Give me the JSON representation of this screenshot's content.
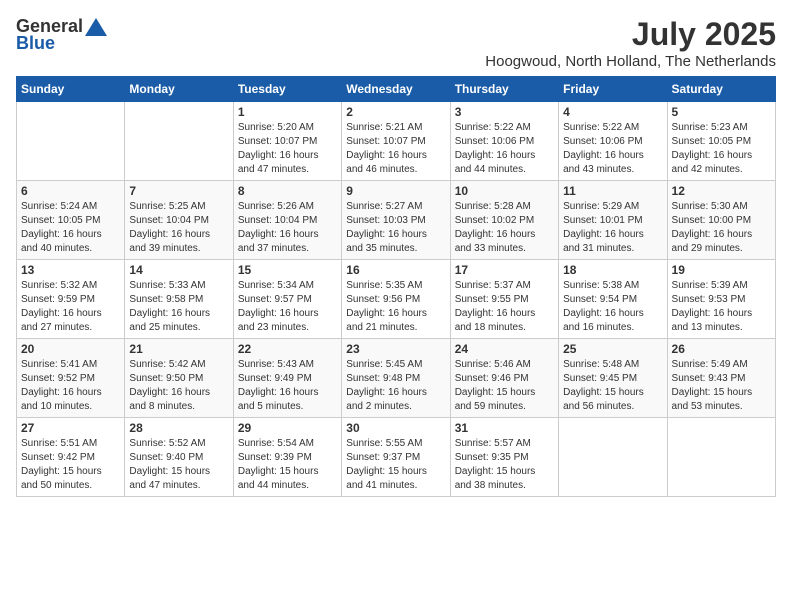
{
  "header": {
    "logo_general": "General",
    "logo_blue": "Blue",
    "month_year": "July 2025",
    "location": "Hoogwoud, North Holland, The Netherlands"
  },
  "days_of_week": [
    "Sunday",
    "Monday",
    "Tuesday",
    "Wednesday",
    "Thursday",
    "Friday",
    "Saturday"
  ],
  "weeks": [
    [
      {
        "day": "",
        "info": ""
      },
      {
        "day": "",
        "info": ""
      },
      {
        "day": "1",
        "info": "Sunrise: 5:20 AM\nSunset: 10:07 PM\nDaylight: 16 hours\nand 47 minutes."
      },
      {
        "day": "2",
        "info": "Sunrise: 5:21 AM\nSunset: 10:07 PM\nDaylight: 16 hours\nand 46 minutes."
      },
      {
        "day": "3",
        "info": "Sunrise: 5:22 AM\nSunset: 10:06 PM\nDaylight: 16 hours\nand 44 minutes."
      },
      {
        "day": "4",
        "info": "Sunrise: 5:22 AM\nSunset: 10:06 PM\nDaylight: 16 hours\nand 43 minutes."
      },
      {
        "day": "5",
        "info": "Sunrise: 5:23 AM\nSunset: 10:05 PM\nDaylight: 16 hours\nand 42 minutes."
      }
    ],
    [
      {
        "day": "6",
        "info": "Sunrise: 5:24 AM\nSunset: 10:05 PM\nDaylight: 16 hours\nand 40 minutes."
      },
      {
        "day": "7",
        "info": "Sunrise: 5:25 AM\nSunset: 10:04 PM\nDaylight: 16 hours\nand 39 minutes."
      },
      {
        "day": "8",
        "info": "Sunrise: 5:26 AM\nSunset: 10:04 PM\nDaylight: 16 hours\nand 37 minutes."
      },
      {
        "day": "9",
        "info": "Sunrise: 5:27 AM\nSunset: 10:03 PM\nDaylight: 16 hours\nand 35 minutes."
      },
      {
        "day": "10",
        "info": "Sunrise: 5:28 AM\nSunset: 10:02 PM\nDaylight: 16 hours\nand 33 minutes."
      },
      {
        "day": "11",
        "info": "Sunrise: 5:29 AM\nSunset: 10:01 PM\nDaylight: 16 hours\nand 31 minutes."
      },
      {
        "day": "12",
        "info": "Sunrise: 5:30 AM\nSunset: 10:00 PM\nDaylight: 16 hours\nand 29 minutes."
      }
    ],
    [
      {
        "day": "13",
        "info": "Sunrise: 5:32 AM\nSunset: 9:59 PM\nDaylight: 16 hours\nand 27 minutes."
      },
      {
        "day": "14",
        "info": "Sunrise: 5:33 AM\nSunset: 9:58 PM\nDaylight: 16 hours\nand 25 minutes."
      },
      {
        "day": "15",
        "info": "Sunrise: 5:34 AM\nSunset: 9:57 PM\nDaylight: 16 hours\nand 23 minutes."
      },
      {
        "day": "16",
        "info": "Sunrise: 5:35 AM\nSunset: 9:56 PM\nDaylight: 16 hours\nand 21 minutes."
      },
      {
        "day": "17",
        "info": "Sunrise: 5:37 AM\nSunset: 9:55 PM\nDaylight: 16 hours\nand 18 minutes."
      },
      {
        "day": "18",
        "info": "Sunrise: 5:38 AM\nSunset: 9:54 PM\nDaylight: 16 hours\nand 16 minutes."
      },
      {
        "day": "19",
        "info": "Sunrise: 5:39 AM\nSunset: 9:53 PM\nDaylight: 16 hours\nand 13 minutes."
      }
    ],
    [
      {
        "day": "20",
        "info": "Sunrise: 5:41 AM\nSunset: 9:52 PM\nDaylight: 16 hours\nand 10 minutes."
      },
      {
        "day": "21",
        "info": "Sunrise: 5:42 AM\nSunset: 9:50 PM\nDaylight: 16 hours\nand 8 minutes."
      },
      {
        "day": "22",
        "info": "Sunrise: 5:43 AM\nSunset: 9:49 PM\nDaylight: 16 hours\nand 5 minutes."
      },
      {
        "day": "23",
        "info": "Sunrise: 5:45 AM\nSunset: 9:48 PM\nDaylight: 16 hours\nand 2 minutes."
      },
      {
        "day": "24",
        "info": "Sunrise: 5:46 AM\nSunset: 9:46 PM\nDaylight: 15 hours\nand 59 minutes."
      },
      {
        "day": "25",
        "info": "Sunrise: 5:48 AM\nSunset: 9:45 PM\nDaylight: 15 hours\nand 56 minutes."
      },
      {
        "day": "26",
        "info": "Sunrise: 5:49 AM\nSunset: 9:43 PM\nDaylight: 15 hours\nand 53 minutes."
      }
    ],
    [
      {
        "day": "27",
        "info": "Sunrise: 5:51 AM\nSunset: 9:42 PM\nDaylight: 15 hours\nand 50 minutes."
      },
      {
        "day": "28",
        "info": "Sunrise: 5:52 AM\nSunset: 9:40 PM\nDaylight: 15 hours\nand 47 minutes."
      },
      {
        "day": "29",
        "info": "Sunrise: 5:54 AM\nSunset: 9:39 PM\nDaylight: 15 hours\nand 44 minutes."
      },
      {
        "day": "30",
        "info": "Sunrise: 5:55 AM\nSunset: 9:37 PM\nDaylight: 15 hours\nand 41 minutes."
      },
      {
        "day": "31",
        "info": "Sunrise: 5:57 AM\nSunset: 9:35 PM\nDaylight: 15 hours\nand 38 minutes."
      },
      {
        "day": "",
        "info": ""
      },
      {
        "day": "",
        "info": ""
      }
    ]
  ]
}
